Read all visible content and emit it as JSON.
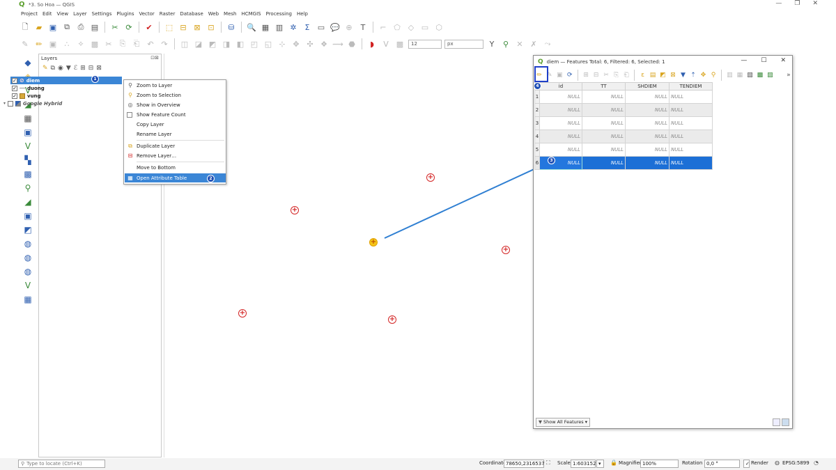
{
  "window": {
    "title": "*3. So Hoa — QGIS",
    "min": "—",
    "restore": "❐",
    "close": "✕"
  },
  "menu": [
    "Project",
    "Edit",
    "View",
    "Layer",
    "Settings",
    "Plugins",
    "Vector",
    "Raster",
    "Database",
    "Web",
    "Mesh",
    "HCMGIS",
    "Processing",
    "Help"
  ],
  "toolbar2": {
    "size_value": "12",
    "unit": "px"
  },
  "layers_panel": {
    "title": "Layers",
    "layers": [
      {
        "name": "diem",
        "checked": "✓",
        "selected": true
      },
      {
        "name": "duong",
        "checked": "✓"
      },
      {
        "name": "vung",
        "checked": "✓"
      },
      {
        "name": "Google Hybrid",
        "checked": ""
      }
    ]
  },
  "context_menu": {
    "items": [
      {
        "label": "Zoom to Layer",
        "icon": "zoom-layer-icon"
      },
      {
        "label": "Zoom to Selection",
        "icon": "zoom-selection-icon"
      },
      {
        "label": "Show in Overview",
        "icon": "overview-icon"
      },
      {
        "label": "Show Feature Count",
        "icon": "checkbox-icon"
      },
      {
        "label": "Copy Layer",
        "icon": ""
      },
      {
        "label": "Rename Layer",
        "icon": ""
      },
      {
        "label": "Duplicate Layer",
        "icon": "duplicate-icon"
      },
      {
        "label": "Remove Layer…",
        "icon": "remove-icon"
      },
      {
        "label": "Move to Bottom",
        "icon": ""
      },
      {
        "label": "Open Attribute Table",
        "icon": "table-icon"
      }
    ]
  },
  "badges": {
    "b1": "1",
    "b2": "2",
    "b3": "3",
    "b4": "4"
  },
  "attr_window": {
    "title": "diem — Features Total: 6, Filtered: 6, Selected: 1",
    "columns": [
      "id",
      "TT",
      "SHDIEM",
      "TENDIEM"
    ],
    "rows": [
      {
        "num": "1",
        "cells": [
          "NULL",
          "NULL",
          "NULL",
          "NULL"
        ]
      },
      {
        "num": "2",
        "cells": [
          "NULL",
          "NULL",
          "NULL",
          "NULL"
        ]
      },
      {
        "num": "3",
        "cells": [
          "NULL",
          "NULL",
          "NULL",
          "NULL"
        ]
      },
      {
        "num": "4",
        "cells": [
          "NULL",
          "NULL",
          "NULL",
          "NULL"
        ]
      },
      {
        "num": "5",
        "cells": [
          "NULL",
          "NULL",
          "NULL",
          "NULL"
        ]
      },
      {
        "num": "6",
        "cells": [
          "NULL",
          "NULL",
          "NULL",
          "NULL"
        ]
      }
    ],
    "show_all_label": "Show All Features",
    "more_glyph": "»"
  },
  "statusbar": {
    "locator_placeholder": "Type to locate (Ctrl+K)",
    "coordinate_label": "Coordinate",
    "coordinate_value": "78650,2316537",
    "scale_label": "Scale",
    "scale_value": "1:603152",
    "magnifier_label": "Magnifier",
    "magnifier_value": "100%",
    "rotation_label": "Rotation",
    "rotation_value": "0,0 °",
    "render_label": "Render",
    "crs_label": "EPSG:5899"
  },
  "colors": {
    "selection_blue": "#1c6fd6",
    "point_red": "#d42626",
    "selected_point_yellow": "#f5c518",
    "badge_blue": "#1f4fb5"
  }
}
